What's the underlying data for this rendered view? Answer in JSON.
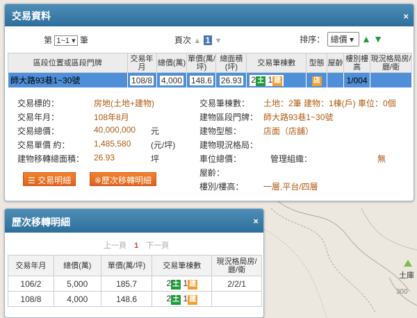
{
  "main_panel": {
    "title": "交易資料",
    "close": "×",
    "pager": {
      "prefix": "第",
      "selected": "1~1",
      "suffix": "筆"
    },
    "page_nav": {
      "label": "頁次",
      "current": "1"
    },
    "sort": {
      "label": "排序：",
      "selected": "總價"
    },
    "columns": [
      "區段位置或區段門牌",
      "交易年月",
      "總價(萬)",
      "單價(萬/坪)",
      "總面積(坪)",
      "交易筆棟數",
      "型態",
      "屋齡",
      "樓別樓高",
      "現況格局房/廳/衛"
    ],
    "row": {
      "address": "師大路93巷1~30號",
      "date": "108/8",
      "total": "4,000",
      "unit": "148.6",
      "area": "26.93",
      "land_count": "2",
      "land_char": "土",
      "bld_count": "1",
      "bld_char": "建",
      "type": "店",
      "age": "",
      "floor": "1/004",
      "layout": ""
    },
    "details": {
      "subject_label": "交易標的：",
      "subject_value": "房地(土地+建物)",
      "date_label": "交易年月：",
      "date_value": "108年8月",
      "total_label": "交易總價：",
      "total_value": "40,000,000",
      "total_unit": "元",
      "unit_label": "交易單價 約：",
      "unit_value": "1,485,580",
      "unit_unit": "(元/坪)",
      "area_label": "建物移轉總面積：",
      "area_value": "26.93",
      "area_unit": "坪",
      "count_label": "交易筆棟數：",
      "count_value": "土地：2筆 建物：1棟(戶) 車位：0個",
      "addr_label": "建物區段門牌：",
      "addr_value": "師大路93巷1~30號",
      "type_label": "建物型態：",
      "type_value": "店面（店舖）",
      "layout_label": "建物現況格局：",
      "layout_value": "",
      "parking_label": "車位總價：",
      "parking_value": "",
      "mgmt_label": "管理組織：",
      "mgmt_value": "無",
      "age_label": "屋齡：",
      "age_value": "",
      "floor_label": "樓別/樓高：",
      "floor_value": "一層,平台/四層"
    },
    "buttons": {
      "detail": "交易明細",
      "history": "※歷次移轉明細"
    }
  },
  "history_panel": {
    "title": "歷次移轉明細",
    "close": "×",
    "pager": {
      "prev": "上一頁",
      "current": "1",
      "next": "下一頁"
    },
    "columns": [
      "交易年月",
      "總價(萬)",
      "單價(萬/坪)",
      "交易筆棟數",
      "現況格局房/廳/衛"
    ],
    "rows": [
      {
        "date": "106/2",
        "total": "5,000",
        "unit": "185.7",
        "land_count": "2",
        "land_char": "土",
        "bld_count": "1",
        "bld_char": "建",
        "layout": "2/2/1"
      },
      {
        "date": "108/8",
        "total": "4,000",
        "unit": "148.6",
        "land_count": "2",
        "land_char": "土",
        "bld_count": "1",
        "bld_char": "建",
        "layout": ""
      }
    ]
  },
  "map": {
    "label": "土庫",
    "contour_label": "300"
  }
}
